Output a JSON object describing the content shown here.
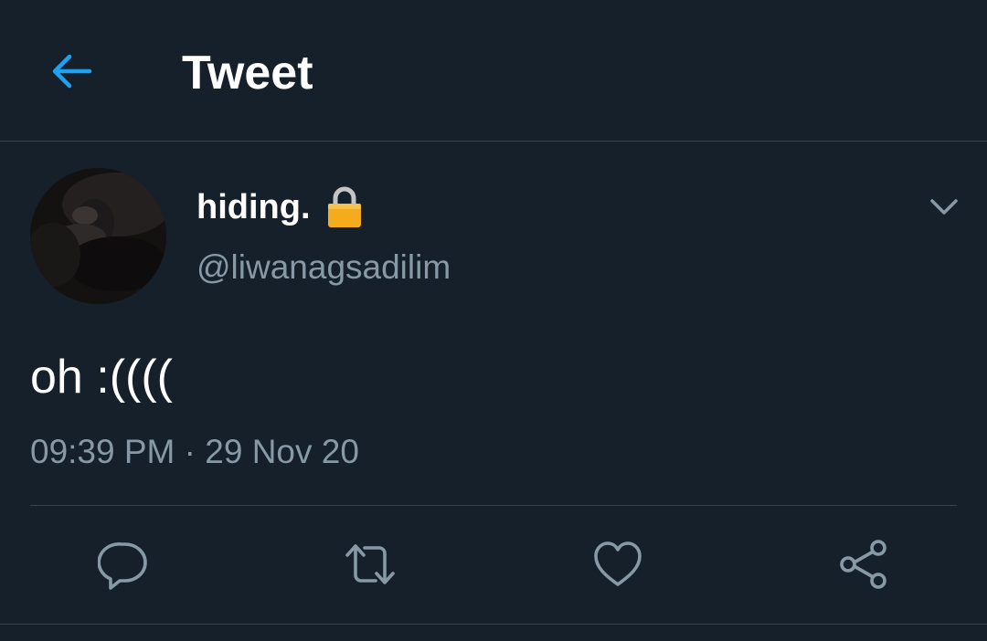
{
  "header": {
    "title": "Tweet",
    "back_icon": "arrow-left-icon"
  },
  "tweet": {
    "display_name": "hiding.",
    "lock_icon": "lock-icon",
    "handle": "@liwanagsadilim",
    "text": "oh :((((",
    "time": "09:39 PM",
    "separator": "·",
    "date": "29 Nov 20",
    "menu_icon": "chevron-down-icon"
  },
  "actions": [
    {
      "icon": "reply-icon"
    },
    {
      "icon": "retweet-icon"
    },
    {
      "icon": "like-icon"
    },
    {
      "icon": "share-icon"
    }
  ],
  "colors": {
    "background": "#15202b",
    "accent": "#1da1f2",
    "text": "#ffffff",
    "secondary": "#8899a6",
    "divider": "#38444d",
    "lock": "#f4ab1c"
  }
}
